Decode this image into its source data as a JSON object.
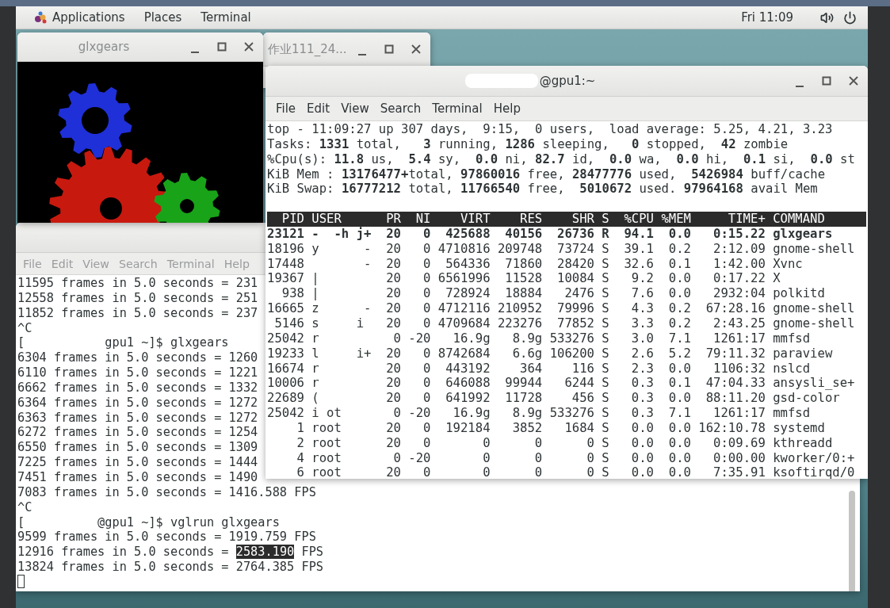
{
  "top_bar": {
    "menus": [
      "Applications",
      "Places",
      "Terminal"
    ],
    "clock": "Fri 11:09"
  },
  "glxgears_window": {
    "title": "glxgears"
  },
  "homework_window": {
    "title": "作业111_24..."
  },
  "terminal_back": {
    "menu": [
      "File",
      "Edit",
      "View",
      "Search",
      "Terminal",
      "Help"
    ],
    "lines": [
      {
        "kind": "text",
        "text": "11595 frames in 5.0 seconds = 231"
      },
      {
        "kind": "text",
        "text": "12558 frames in 5.0 seconds = 251"
      },
      {
        "kind": "text",
        "text": "11852 frames in 5.0 seconds = 237"
      },
      {
        "kind": "text",
        "text": "^C"
      },
      {
        "kind": "text",
        "text": "[           gpu1 ~]$ glxgears"
      },
      {
        "kind": "text",
        "text": "6304 frames in 5.0 seconds = 1260"
      },
      {
        "kind": "text",
        "text": "6110 frames in 5.0 seconds = 1221"
      },
      {
        "kind": "text",
        "text": "6662 frames in 5.0 seconds = 1332"
      },
      {
        "kind": "text",
        "text": "6364 frames in 5.0 seconds = 1272"
      },
      {
        "kind": "text",
        "text": "6363 frames in 5.0 seconds = 1272"
      },
      {
        "kind": "text",
        "text": "6272 frames in 5.0 seconds = 1254"
      },
      {
        "kind": "text",
        "text": "6550 frames in 5.0 seconds = 1309"
      },
      {
        "kind": "text",
        "text": "7225 frames in 5.0 seconds = 1444"
      },
      {
        "kind": "text",
        "text": "7451 frames in 5.0 seconds = 1490"
      },
      {
        "kind": "text",
        "text": "7083 frames in 5.0 seconds = 1416.588 FPS"
      },
      {
        "kind": "text",
        "text": "^C"
      },
      {
        "kind": "text",
        "text": "[          @gpu1 ~]$ vglrun glxgears"
      },
      {
        "kind": "text",
        "text": "9599 frames in 5.0 seconds = 1919.759 FPS"
      },
      {
        "kind": "selection",
        "before": "12916 frames in 5.0 seconds = ",
        "highlight": "2583.190",
        "after": " FPS"
      },
      {
        "kind": "text",
        "text": "13824 frames in 5.0 seconds = 2764.385 FPS"
      },
      {
        "kind": "cursor"
      }
    ]
  },
  "terminal_front": {
    "title": "@gpu1:~",
    "menu": [
      "File",
      "Edit",
      "View",
      "Search",
      "Terminal",
      "Help"
    ],
    "summary": [
      "top - 11:09:27 up 307 days,  9:15,  0 users,  load average: 5.25, 4.21, 3.23",
      "Tasks: **1331** total,   **3** running, **1286** sleeping,   **0** stopped,  **42** zombie",
      "%Cpu(s): **11.8** us,  **5.4** sy,  **0.0** ni, **82.7** id,  **0.0** wa,  **0.0** hi,  **0.1** si,  **0.0** st",
      "KiB Mem : **13176477+**total, **97860016** free, **28477776** used,  **5426984** buff/cache",
      "KiB Swap: **16777212** total, **11766540** free,  **5010672** used. **97964168** avail Mem"
    ],
    "table": {
      "columns": [
        "PID",
        "USER",
        "PR",
        "NI",
        "VIRT",
        "RES",
        "SHR",
        "S",
        "%CPU",
        "%MEM",
        "TIME+",
        "COMMAND"
      ],
      "rows": [
        {
          "running": true,
          "cells": [
            "23121",
            "-  -h j+",
            "20",
            "0",
            "425688",
            "40156",
            "26736",
            "R",
            "94.1",
            "0.0",
            "0:15.22",
            "glxgears"
          ]
        },
        {
          "running": false,
          "cells": [
            "18196",
            "y      -",
            "20",
            "0",
            "4710816",
            "209748",
            "73724",
            "S",
            "39.1",
            "0.2",
            "2:12.09",
            "gnome-shell"
          ]
        },
        {
          "running": false,
          "cells": [
            "17448",
            "       -",
            "20",
            "0",
            "564336",
            "71860",
            "28420",
            "S",
            "32.6",
            "0.1",
            "1:42.00",
            "Xvnc"
          ]
        },
        {
          "running": false,
          "cells": [
            "19367",
            "|",
            "20",
            "0",
            "6561996",
            "11528",
            "10084",
            "S",
            "9.2",
            "0.0",
            "0:17.22",
            "X"
          ]
        },
        {
          "running": false,
          "cells": [
            "938",
            "|",
            "20",
            "0",
            "728924",
            "18884",
            "2476",
            "S",
            "7.6",
            "0.0",
            "2932:04",
            "polkitd"
          ]
        },
        {
          "running": false,
          "cells": [
            "16665",
            "z      -",
            "20",
            "0",
            "4712116",
            "210952",
            "79996",
            "S",
            "4.3",
            "0.2",
            "67:28.16",
            "gnome-shell"
          ]
        },
        {
          "running": false,
          "cells": [
            "5146",
            "s     i",
            "20",
            "0",
            "4709684",
            "223276",
            "77852",
            "S",
            "3.3",
            "0.2",
            "2:43.25",
            "gnome-shell"
          ]
        },
        {
          "running": false,
          "cells": [
            "25042",
            "r",
            "0",
            "-20",
            "16.9g",
            "8.9g",
            "533276",
            "S",
            "3.0",
            "7.1",
            "1261:17",
            "mmfsd"
          ]
        },
        {
          "running": false,
          "cells": [
            "19233",
            "l     i+",
            "20",
            "0",
            "8742684",
            "6.6g",
            "106200",
            "S",
            "2.6",
            "5.2",
            "79:11.32",
            "paraview"
          ]
        },
        {
          "running": false,
          "cells": [
            "16674",
            "r",
            "20",
            "0",
            "443192",
            "364",
            "116",
            "S",
            "2.3",
            "0.0",
            "1106:32",
            "nslcd"
          ]
        },
        {
          "running": false,
          "cells": [
            "10006",
            "r",
            "20",
            "0",
            "646088",
            "99944",
            "6244",
            "S",
            "0.3",
            "0.1",
            "47:04.33",
            "ansysli_se+"
          ]
        },
        {
          "running": false,
          "cells": [
            "22689",
            "(",
            "20",
            "0",
            "641992",
            "11728",
            "456",
            "S",
            "0.3",
            "0.0",
            "88:11.20",
            "gsd-color"
          ]
        },
        {
          "running": false,
          "cells": [
            "25042",
            "i ot",
            "0",
            "-20",
            "16.9g",
            "8.9g",
            "533276",
            "S",
            "0.3",
            "7.1",
            "1261:17",
            "mmfsd"
          ]
        },
        {
          "running": false,
          "cells": [
            "1",
            "root",
            "20",
            "0",
            "192184",
            "3852",
            "1684",
            "S",
            "0.0",
            "0.0",
            "162:10.78",
            "systemd"
          ]
        },
        {
          "running": false,
          "cells": [
            "2",
            "root",
            "20",
            "0",
            "0",
            "0",
            "0",
            "S",
            "0.0",
            "0.0",
            "0:09.69",
            "kthreadd"
          ]
        },
        {
          "running": false,
          "cells": [
            "4",
            "root",
            "0",
            "-20",
            "0",
            "0",
            "0",
            "S",
            "0.0",
            "0.0",
            "0:00.00",
            "kworker/0:+"
          ]
        },
        {
          "running": false,
          "cells": [
            "6",
            "root",
            "20",
            "0",
            "0",
            "0",
            "0",
            "S",
            "0.0",
            "0.0",
            "7:35.91",
            "ksoftirqd/0"
          ]
        }
      ]
    }
  }
}
